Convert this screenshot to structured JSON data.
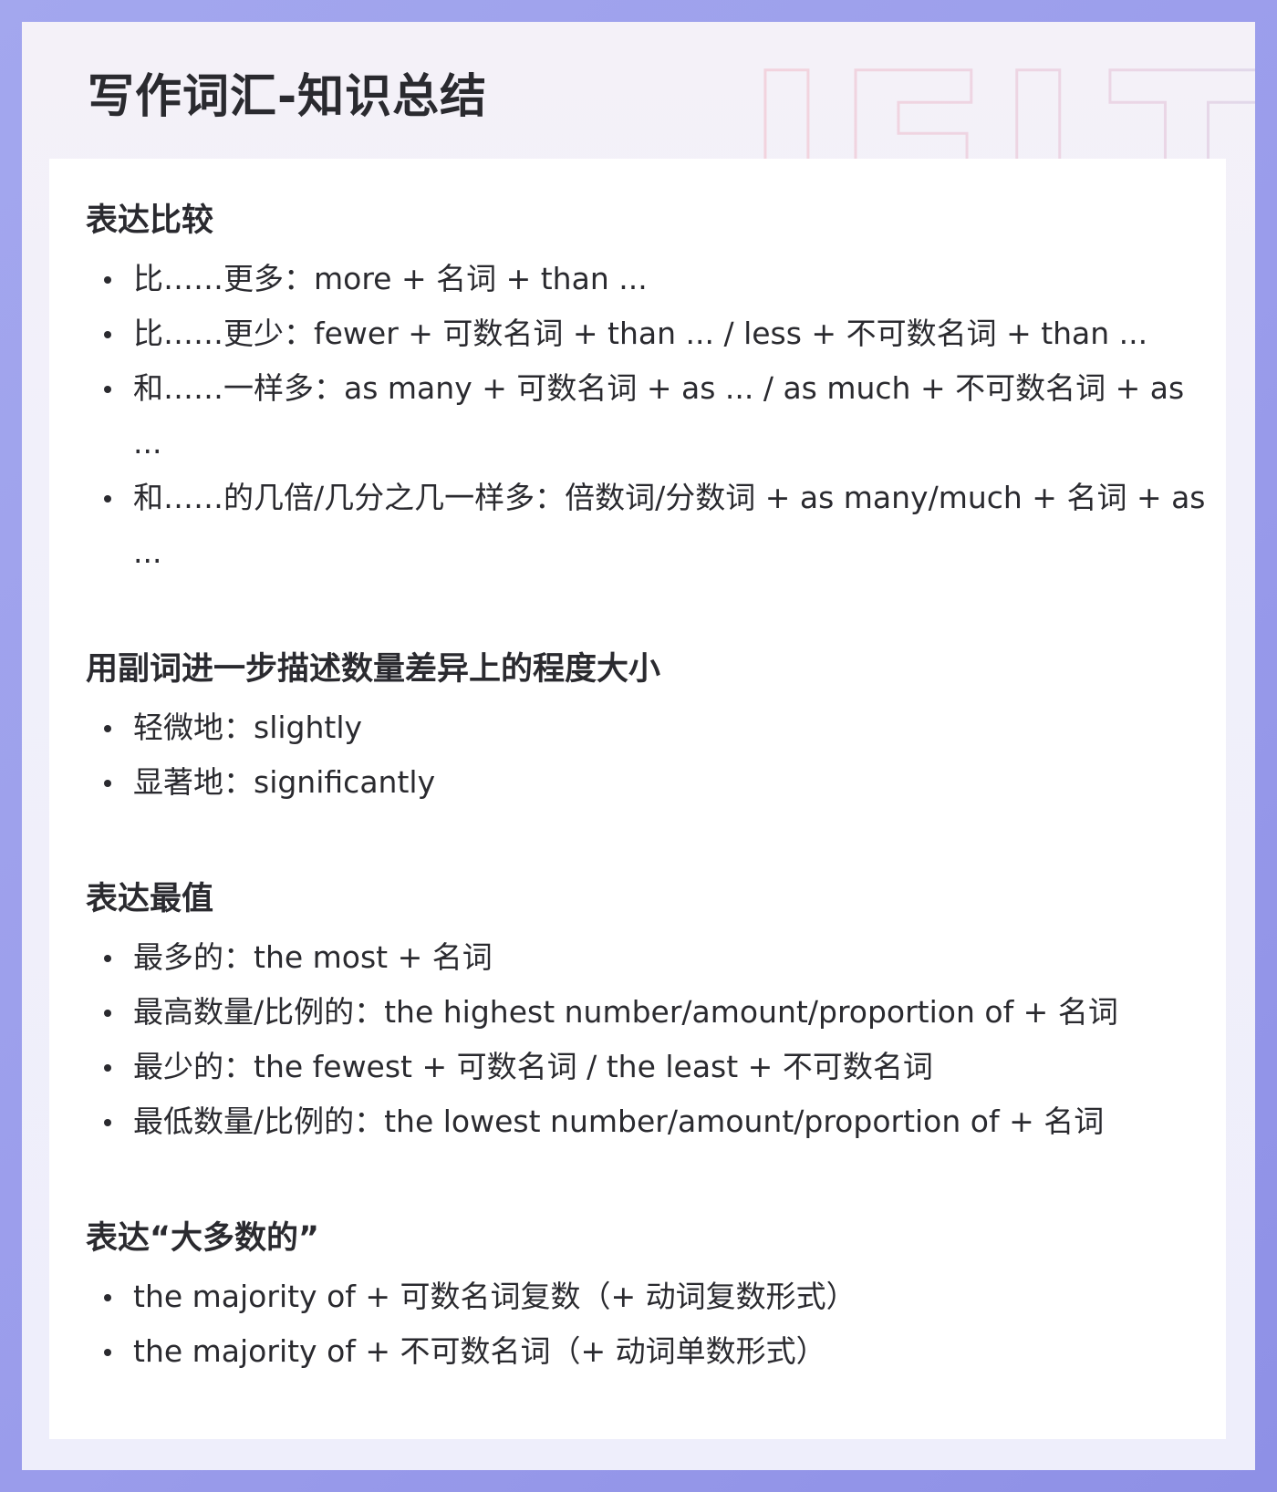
{
  "page": {
    "title": "写作词汇-知识总结",
    "watermark_text": "IELTS",
    "colors": {
      "frame": "#9a9ceb",
      "card": "#f2f0f9",
      "content_bg": "#ffffff",
      "text": "#2a2a2f",
      "watermark_pink": "#f3d3dd",
      "watermark_blue": "#cfdcf2"
    }
  },
  "sections": [
    {
      "heading": "表达比较",
      "items": [
        "比……更多：more + 名词 + than ...",
        "比……更少：fewer + 可数名词 + than ... / less + 不可数名词 + than ...",
        "和……一样多：as many + 可数名词 + as ... / as much + 不可数名词 + as ...",
        "和……的几倍/几分之几一样多：倍数词/分数词 + as many/much + 名词 + as ..."
      ]
    },
    {
      "heading": "用副词进一步描述数量差异上的程度大小",
      "items": [
        "轻微地：slightly",
        "显著地：significantly"
      ]
    },
    {
      "heading": "表达最值",
      "items": [
        "最多的：the most + 名词",
        "最高数量/比例的：the highest number/amount/proportion of + 名词",
        "最少的：the fewest + 可数名词 / the least + 不可数名词",
        "最低数量/比例的：the lowest number/amount/proportion of + 名词"
      ]
    },
    {
      "heading": "表达“大多数的”",
      "items": [
        "the majority of + 可数名词复数（+ 动词复数形式）",
        "the majority of + 不可数名词（+ 动词单数形式）"
      ]
    }
  ]
}
